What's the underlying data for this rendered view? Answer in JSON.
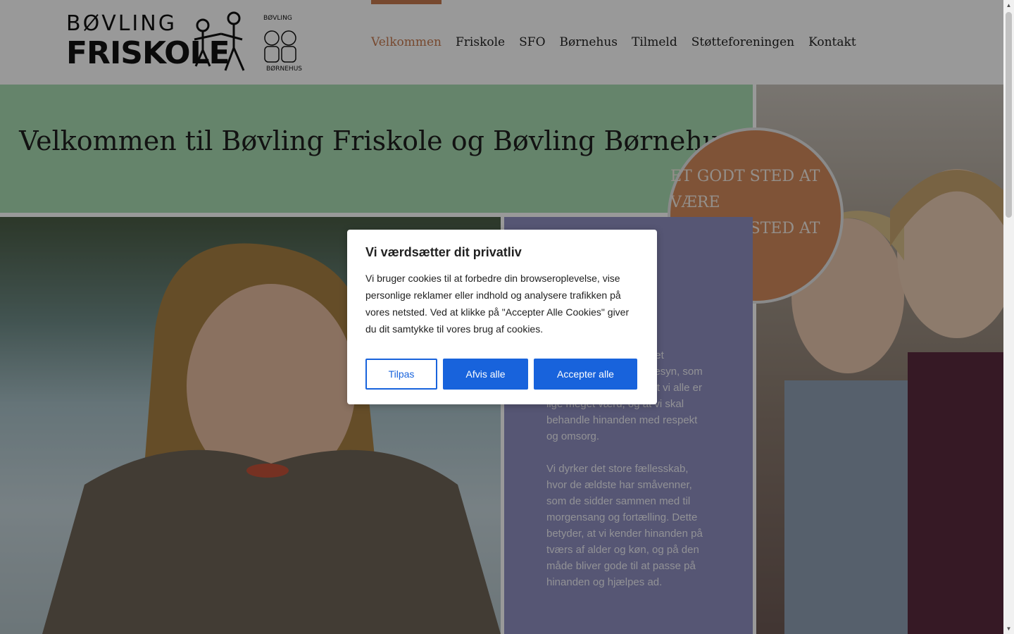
{
  "header": {
    "logo": {
      "line1": "BØVLING",
      "line2": "FRISKOLE",
      "badge_top": "BØVLING",
      "badge_bottom": "BØRNEHUS"
    },
    "nav": [
      {
        "label": "Velkommen",
        "active": true
      },
      {
        "label": "Friskole"
      },
      {
        "label": "SFO"
      },
      {
        "label": "Børnehus"
      },
      {
        "label": "Tilmeld"
      },
      {
        "label": "Støtteforeningen"
      },
      {
        "label": "Kontakt"
      }
    ]
  },
  "hero": {
    "title": "Velkommen til Bøvling Friskole og Bøvling Børnehus",
    "circle_line1": "ET GODT STED AT VÆRE",
    "circle_line2": "ET GODT STED AT LÆRE"
  },
  "panel": {
    "paragraph1": "af Bøvling rnehus. på det Grundtvigske menneskesyn, som tager udgangspunkt i, at vi alle er lige meget værd, og at vi skal behandle hinanden med respekt og omsorg.",
    "paragraph2": "Vi dyrker det store fællesskab, hvor de ældste har småvenner, som de sidder sammen med til morgensang og fortælling. Dette betyder, at vi kender hinanden på tværs af alder og køn, og på den måde bliver gode til at passe på hinanden og hjælpes ad."
  },
  "cookie": {
    "title": "Vi værdsætter dit privatliv",
    "text": "Vi bruger cookies til at forbedre din browseroplevelse, vise personlige reklamer eller indhold og analysere trafikken på vores netsted. Ved at klikke på \"Accepter Alle Cookies\" giver du dit samtykke til vores brug af cookies.",
    "customize_label": "Tilpas",
    "reject_label": "Afvis alle",
    "accept_label": "Accepter alle"
  },
  "colors": {
    "accent": "#c77a4f",
    "hero_band": "#a9ddb2",
    "panel": "#8f8fc2",
    "circle": "#d48a5c",
    "button_primary": "#1863dc"
  }
}
